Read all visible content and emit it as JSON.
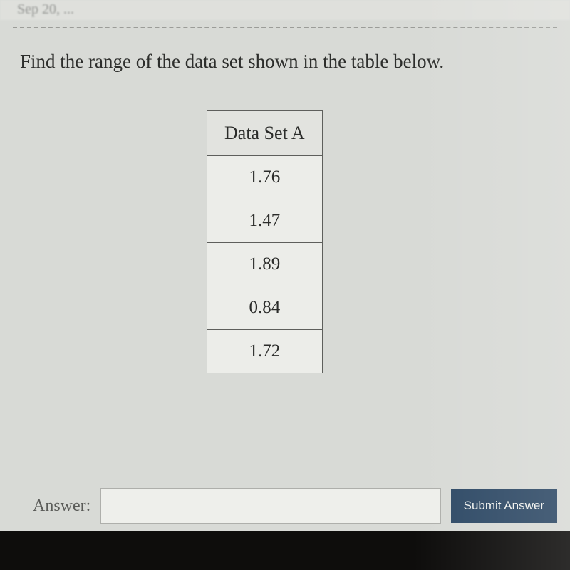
{
  "top_cut_text": "Sep 20, ...",
  "question_text": "Find the range of the data set shown in the table below.",
  "table": {
    "header": "Data Set A",
    "rows": [
      "1.76",
      "1.47",
      "1.89",
      "0.84",
      "1.72"
    ]
  },
  "answer_label": "Answer:",
  "submit_label": "Submit Answer",
  "chart_data": {
    "type": "table",
    "title": "Data Set A",
    "categories": [
      "Value"
    ],
    "series": [
      {
        "name": "Data Set A",
        "values": [
          1.76,
          1.47,
          1.89,
          0.84,
          1.72
        ]
      }
    ]
  }
}
